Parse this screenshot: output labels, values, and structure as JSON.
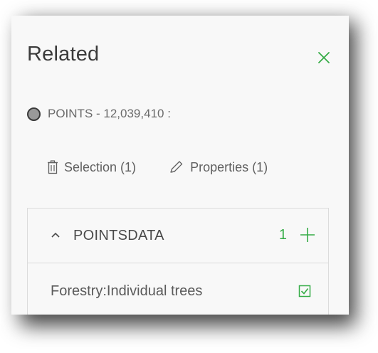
{
  "panel": {
    "title": "Related",
    "close_icon": "close-icon"
  },
  "feature": {
    "label": "POINTS - 12,039,410 :",
    "symbol_color": "#9a9a9a"
  },
  "actions": [
    {
      "label": "Selection (1)",
      "icon": "trash-icon"
    },
    {
      "label": "Properties (1)",
      "icon": "pencil-icon"
    }
  ],
  "related_group": {
    "name": "POINTSDATA",
    "count": "1",
    "expanded": true,
    "records": [
      {
        "label": "Forestry:Individual trees",
        "checked": true
      }
    ]
  },
  "colors": {
    "accent": "#35ac46",
    "text": "#3b3b3b",
    "panel_background": "#f8f8f8"
  }
}
